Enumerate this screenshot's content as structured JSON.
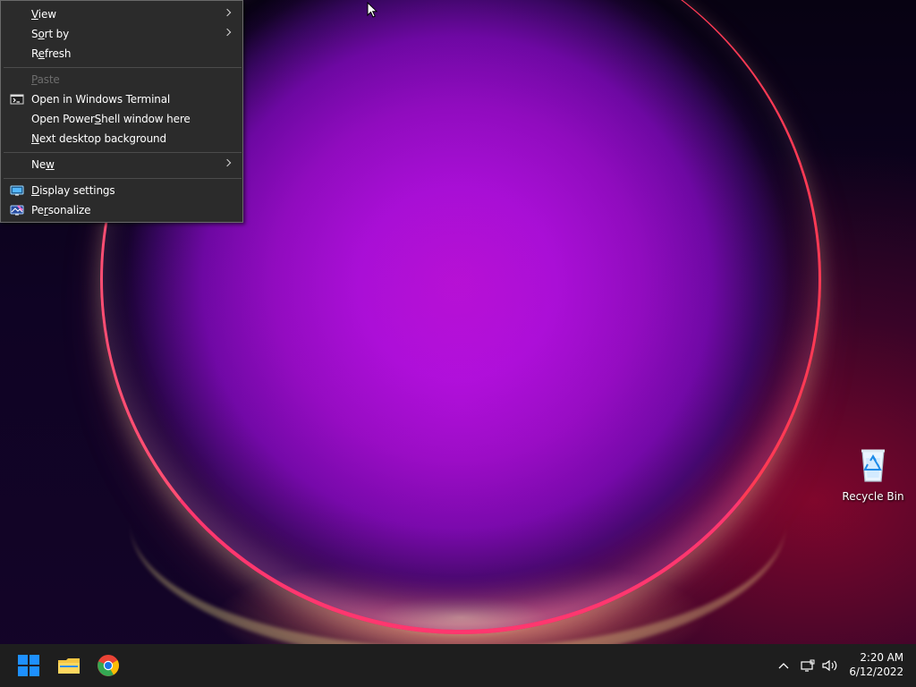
{
  "desktop": {
    "context_menu": {
      "items": [
        {
          "label": "View",
          "access_key": "V",
          "enabled": true,
          "has_submenu": true
        },
        {
          "label": "Sort by",
          "access_key": "o",
          "enabled": true,
          "has_submenu": true
        },
        {
          "label": "Refresh",
          "access_key": "e",
          "enabled": true,
          "has_submenu": false
        },
        {
          "label": "Paste",
          "access_key": "P",
          "enabled": false,
          "has_submenu": false
        },
        {
          "label": "Open in Windows Terminal",
          "access_key": "",
          "enabled": true,
          "has_submenu": false,
          "icon": "terminal-icon"
        },
        {
          "label": "Open PowerShell window here",
          "access_key": "S",
          "enabled": true,
          "has_submenu": false
        },
        {
          "label": "Next desktop background",
          "access_key": "N",
          "enabled": true,
          "has_submenu": false
        },
        {
          "label": "New",
          "access_key": "w",
          "enabled": true,
          "has_submenu": true
        },
        {
          "label": "Display settings",
          "access_key": "D",
          "enabled": true,
          "has_submenu": false,
          "icon": "display-settings-icon"
        },
        {
          "label": "Personalize",
          "access_key": "r",
          "enabled": true,
          "has_submenu": false,
          "icon": "personalize-icon"
        }
      ]
    },
    "icons": [
      {
        "label": "Recycle Bin",
        "icon": "recycle-bin-icon"
      }
    ]
  },
  "taskbar": {
    "apps": [
      {
        "name": "Start",
        "icon": "windows-start-icon"
      },
      {
        "name": "File Explorer",
        "icon": "folder-icon"
      },
      {
        "name": "Google Chrome",
        "icon": "chrome-icon"
      }
    ],
    "tray": {
      "icons": [
        "chevron-up-icon",
        "network-icon",
        "speaker-icon"
      ],
      "time": "2:20 AM",
      "date": "6/12/2022"
    }
  },
  "colors": {
    "menu_background": "#2b2b2b",
    "menu_border": "#6a6a6a",
    "disabled_text": "#6d6d6d",
    "taskbar_background": "#1e1e1e",
    "windows_blue": "#1e90ff",
    "folder_yellow": "#f4c542"
  }
}
